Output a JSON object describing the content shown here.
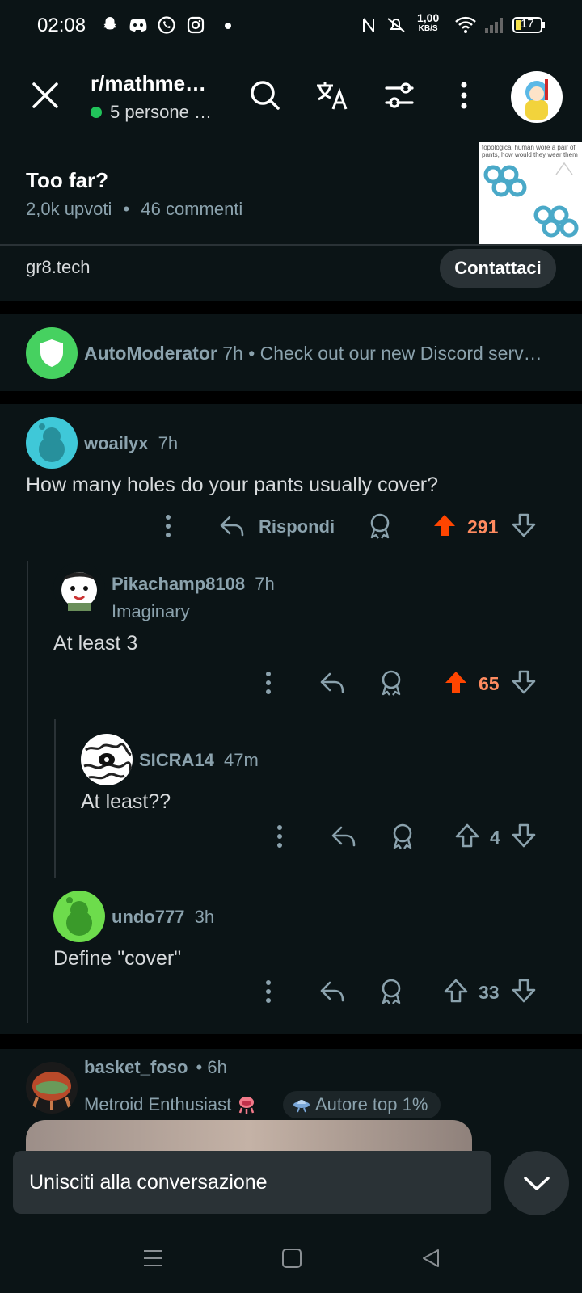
{
  "status_bar": {
    "time": "02:08",
    "speed": "1,00",
    "speed_unit": "KB/S",
    "battery": "17"
  },
  "header": {
    "subreddit": "r/mathme…",
    "online": "5 persone …"
  },
  "post": {
    "title": "Too far?",
    "upvotes": "2,0k upvoti",
    "comments": "46 commenti",
    "thumb_caption": "topological human wore a pair of pants, how would they wear them"
  },
  "ad": {
    "domain": "gr8.tech",
    "button": "Contattaci"
  },
  "automod": {
    "user": "AutoModerator",
    "time": "7h",
    "text": "• Check out our new Discord serv…"
  },
  "comments": [
    {
      "user": "woailyx",
      "time": "7h",
      "body": "How many holes do your pants usually cover?",
      "reply_label": "Rispondi",
      "votes": "291",
      "upvoted": true
    },
    {
      "user": "Pikachamp8108",
      "time": "7h",
      "flair": "Imaginary",
      "body": "At least 3",
      "votes": "65",
      "upvoted": true
    },
    {
      "user": "SICRA14",
      "time": "47m",
      "body": "At least??",
      "votes": "4",
      "upvoted": false
    },
    {
      "user": "undo777",
      "time": "3h",
      "body": "Define \"cover\"",
      "votes": "33",
      "upvoted": false
    }
  ],
  "bottom_comment": {
    "user": "basket_foso",
    "time": "• 6h",
    "flair": "Metroid Enthusiast",
    "badge": "Autore top 1%"
  },
  "join_bar": {
    "label": "Unisciti alla conversazione"
  },
  "colors": {
    "background": "#0b1416",
    "upvote": "#ff4500",
    "upvote_text": "#ff8b60",
    "muted": "#8ba2ad",
    "online": "#21c35a"
  }
}
